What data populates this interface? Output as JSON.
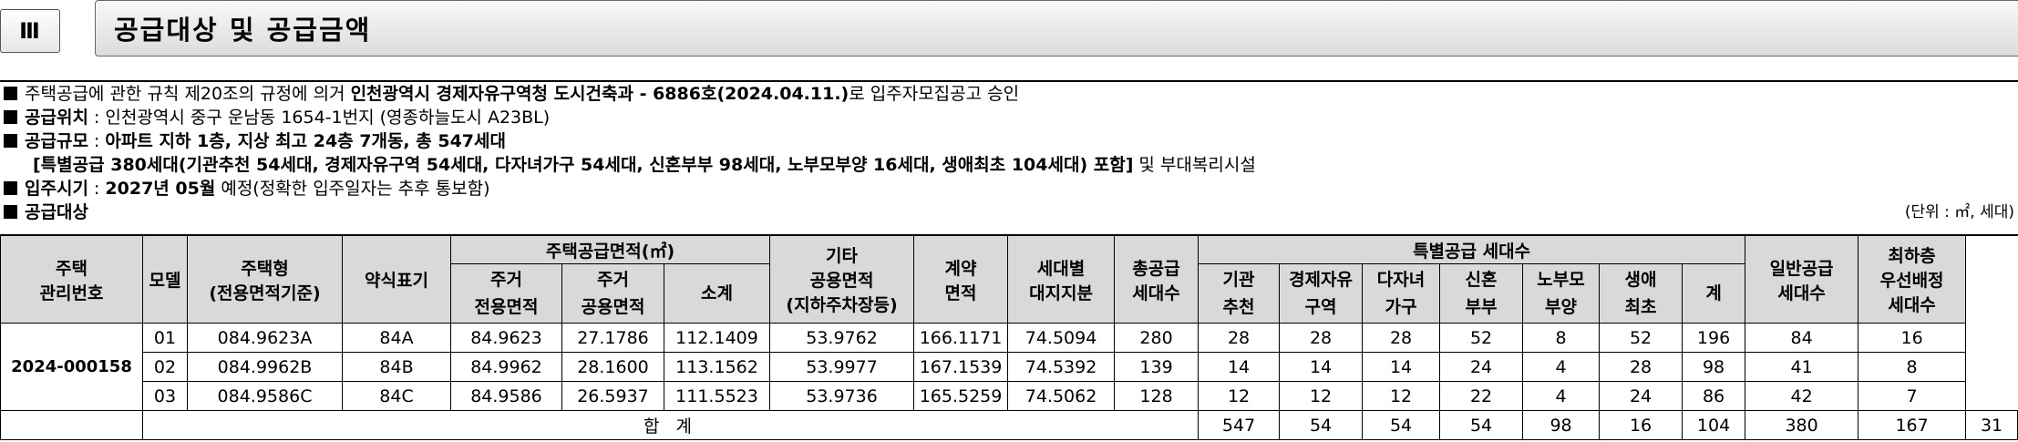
{
  "section": {
    "number": "Ⅲ",
    "title": "공급대상 및 공급금액"
  },
  "lines": {
    "l1": {
      "pre": "주택공급에 관한 규칙 제20조의 규정에 의거 ",
      "bold": "인천광역시 경제자유구역청 도시건축과 - 6886호(2024.04.11.)",
      "post": "로 입주자모집공고 승인"
    },
    "l2": {
      "label": "공급위치",
      "sep": " : ",
      "text": "인천광역시 중구 운남동 1654-1번지 (영종하늘도시 A23BL)"
    },
    "l3": {
      "label": "공급규모",
      "sep": " : ",
      "bold": "아파트 지하 1층, 지상 최고 24층 7개동, 총 547세대"
    },
    "l4": {
      "bold": "[특별공급 380세대(기관추천 54세대, 경제자유구역 54세대, 다자녀가구 54세대, 신혼부부 98세대, 노부모부양 16세대, 생애최초 104세대) 포함]",
      "post": " 및 부대복리시설"
    },
    "l5": {
      "label": "입주시기",
      "sep": " : ",
      "bold": "2027년 05월",
      "post": " 예정(정확한 입주일자는 추후 통보함)"
    },
    "l6": {
      "label": "공급대상",
      "unit": "(단위 : ㎡, 세대)"
    }
  },
  "table": {
    "headers": {
      "house_no": "주택\n관리번호",
      "model": "모델",
      "house_type": "주택형\n(전용면적기준)",
      "abbr": "약식표기",
      "supply_area": "주택공급면적(㎡)",
      "exclusive": "주거\n전용면적",
      "common": "주거\n공용면적",
      "subtotal": "소계",
      "other": "기타\n공용면적\n(지하주차장등)",
      "contract": "계약\n면적",
      "land": "세대별\n대지지분",
      "total": "총공급\n세대수",
      "special": "특별공급 세대수",
      "s_agency": "기관\n추천",
      "s_fez": "경제자유\n구역",
      "s_multi": "다자녀\n가구",
      "s_newlywed": "신혼\n부부",
      "s_parents": "노부모\n부양",
      "s_first": "생애\n최초",
      "s_sum": "계",
      "general": "일반공급\n세대수",
      "lowest": "최하층\n우선배정\n세대수"
    },
    "management_no": "2024-000158",
    "rows": [
      {
        "model": "01",
        "type": "084.9623A",
        "abbr": "84A",
        "excl": "84.9623",
        "comm": "27.1786",
        "sub": "112.1409",
        "other": "53.9762",
        "contract": "166.1171",
        "land": "74.5094",
        "total": "280",
        "agency": "28",
        "fez": "28",
        "multi": "28",
        "newlywed": "52",
        "parents": "8",
        "first": "52",
        "ssum": "196",
        "general": "84",
        "lowest": "16"
      },
      {
        "model": "02",
        "type": "084.9962B",
        "abbr": "84B",
        "excl": "84.9962",
        "comm": "28.1600",
        "sub": "113.1562",
        "other": "53.9977",
        "contract": "167.1539",
        "land": "74.5392",
        "total": "139",
        "agency": "14",
        "fez": "14",
        "multi": "14",
        "newlywed": "24",
        "parents": "4",
        "first": "28",
        "ssum": "98",
        "general": "41",
        "lowest": "8"
      },
      {
        "model": "03",
        "type": "084.9586C",
        "abbr": "84C",
        "excl": "84.9586",
        "comm": "26.5937",
        "sub": "111.5523",
        "other": "53.9736",
        "contract": "165.5259",
        "land": "74.5062",
        "total": "128",
        "agency": "12",
        "fez": "12",
        "multi": "12",
        "newlywed": "22",
        "parents": "4",
        "first": "24",
        "ssum": "86",
        "general": "42",
        "lowest": "7"
      }
    ],
    "totals": {
      "label": "합 계",
      "total": "547",
      "agency": "54",
      "fez": "54",
      "multi": "54",
      "newlywed": "98",
      "parents": "16",
      "first": "104",
      "ssum": "380",
      "general": "167",
      "lowest": "31"
    }
  }
}
